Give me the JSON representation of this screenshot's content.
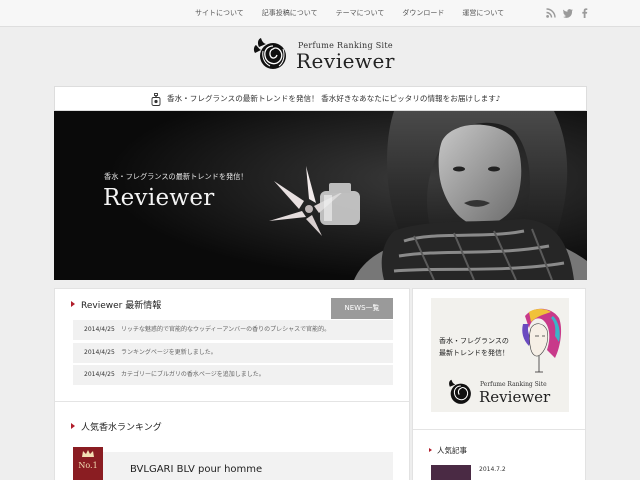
{
  "nav": {
    "items": [
      "サイトについて",
      "記事投稿について",
      "テーマについて",
      "ダウンロード",
      "運営について"
    ]
  },
  "social": [
    "rss-icon",
    "twitter-icon",
    "facebook-icon"
  ],
  "header": {
    "logo_sub": "Perfume Ranking Site",
    "logo_main": "Reviewer"
  },
  "announcement": {
    "text": "香水・フレグランスの最新トレンドを発信！ 香水好きなあなたにピッタリの情報をお届けします♪"
  },
  "hero": {
    "tagline": "香水・フレグランスの最新トレンドを発信！",
    "title": "Reviewer"
  },
  "news": {
    "heading": "Reviewer 最新情報",
    "button": "NEWS一覧",
    "items": [
      {
        "date": "2014/4/25",
        "title": "リッチな魅惑的で官能的なウッディーアンバーの香りのプレシャスで官能的。"
      },
      {
        "date": "2014/4/25",
        "title": "ランキングページを更新しました。"
      },
      {
        "date": "2014/4/25",
        "title": "カテゴリーにブルガリの香水ページを追加しました。"
      }
    ]
  },
  "ranking": {
    "heading": "人気香水ランキング",
    "badge": "No.1",
    "first_name": "BVLGARI BLV pour homme"
  },
  "sidebar": {
    "banner_line1": "香水・フレグランスの",
    "banner_line2": "最新トレンドを発信！",
    "banner_sub": "Perfume Ranking Site",
    "banner_main": "Reviewer",
    "popular_heading": "人気記事",
    "popular_date": "2014.7.2"
  },
  "colors": {
    "accent": "#b11d2b",
    "badge": "#8a1d22",
    "button": "#9a9a9a"
  }
}
